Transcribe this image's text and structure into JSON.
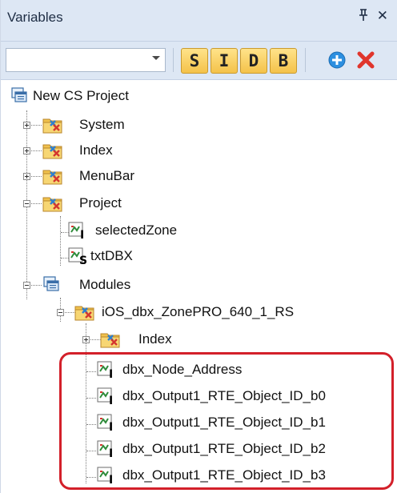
{
  "panel": {
    "title": "Variables",
    "pin_glyph": "т",
    "close_glyph": "✕"
  },
  "toolbar": {
    "filter_value": "",
    "buttons": [
      "S",
      "I",
      "D",
      "B"
    ],
    "add_icon": "plus-circle-icon",
    "delete_icon": "red-x-icon"
  },
  "tree": {
    "root": "New CS Project",
    "system": "System",
    "index": "Index",
    "menubar": "MenuBar",
    "project": "Project",
    "project_children": [
      "selectedZone",
      "txtDBX"
    ],
    "modules": "Modules",
    "module_name": "iOS_dbx_ZonePRO_640_1_RS",
    "module_index": "Index",
    "module_vars": [
      "dbx_Node_Address",
      "dbx_Output1_RTE_Object_ID_b0",
      "dbx_Output1_RTE_Object_ID_b1",
      "dbx_Output1_RTE_Object_ID_b2",
      "dbx_Output1_RTE_Object_ID_b3"
    ]
  },
  "colors": {
    "header_bg": "#dde7f4",
    "button_gold": "#f4c24a",
    "highlight_red": "#d3202a"
  }
}
